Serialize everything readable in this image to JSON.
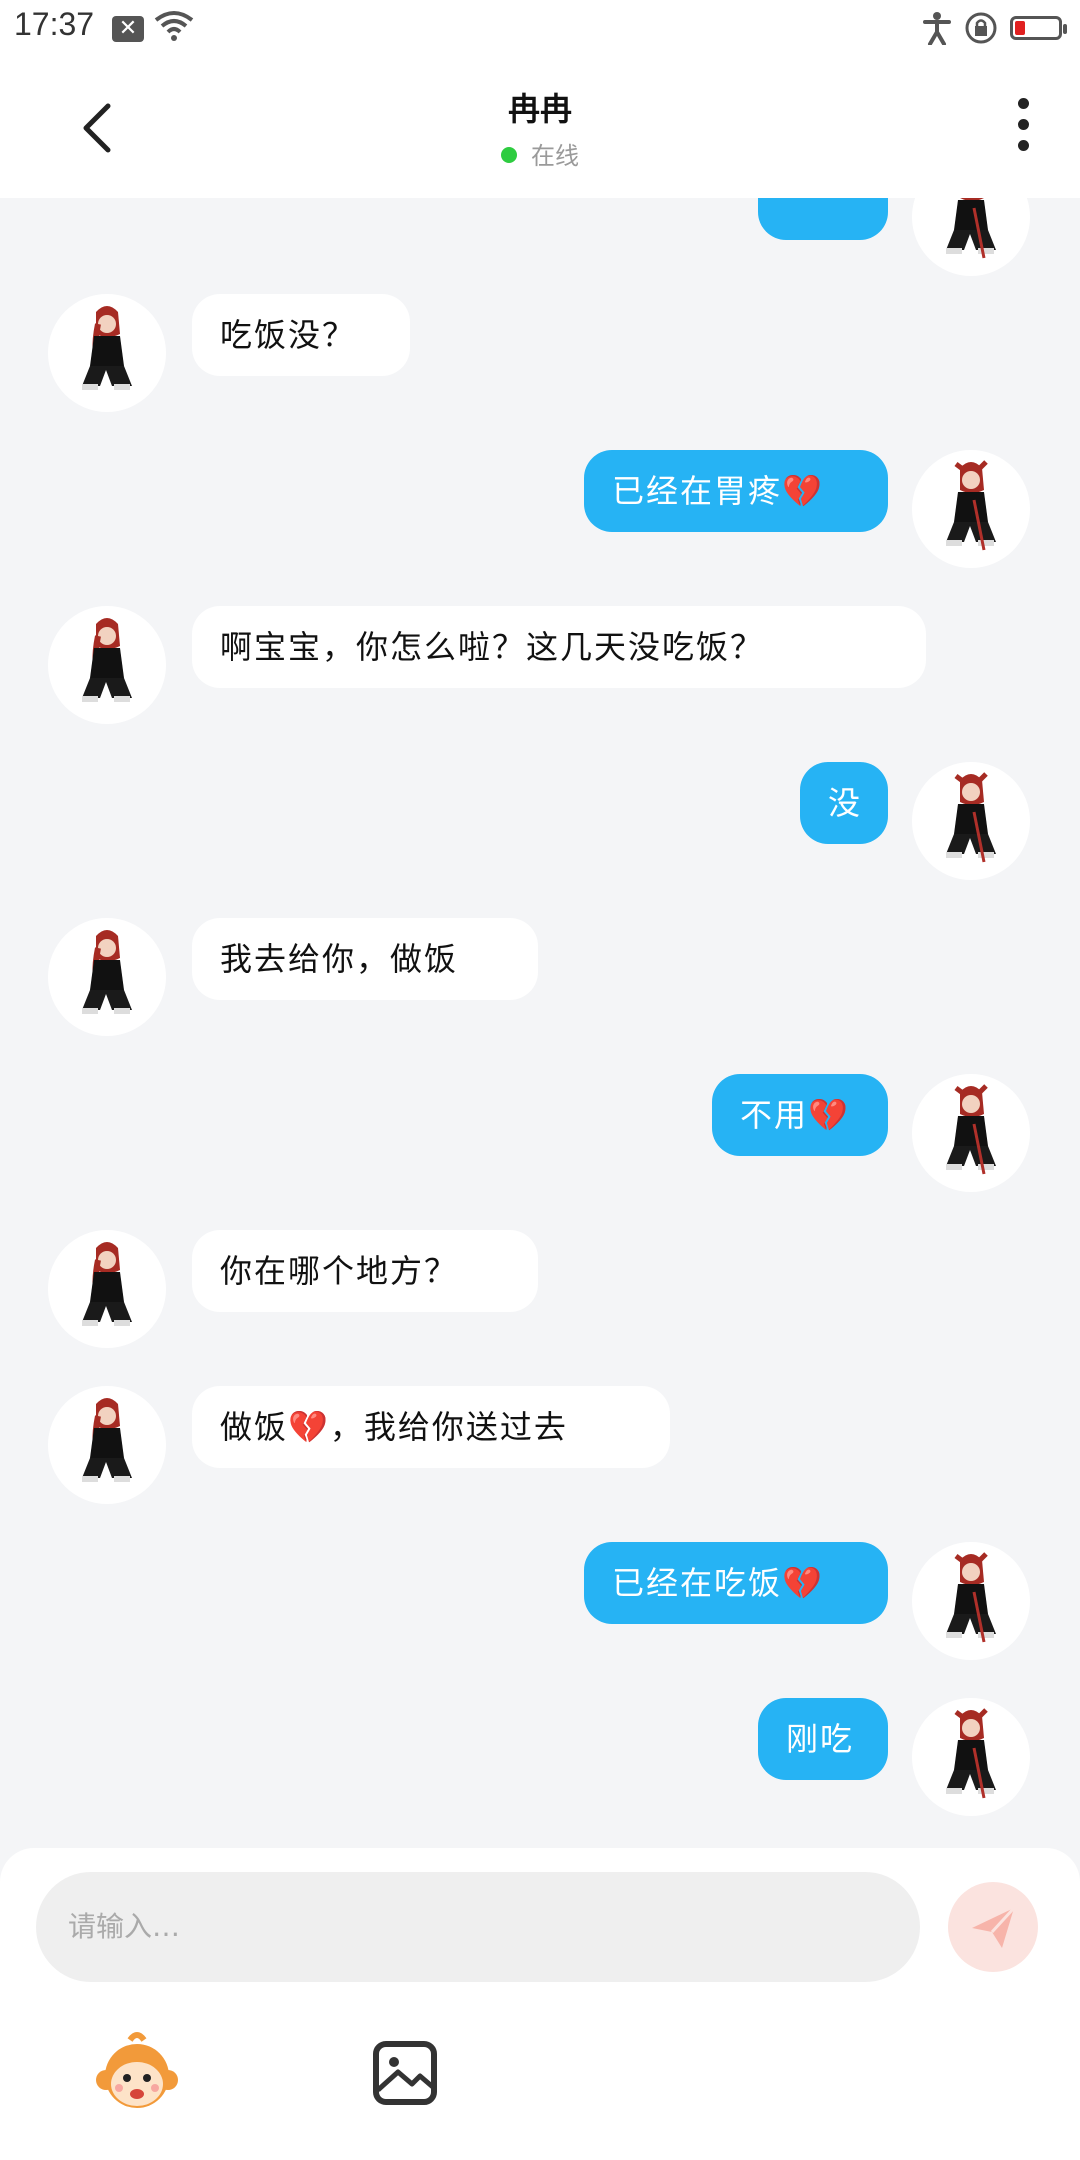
{
  "status_bar": {
    "time": "17:37"
  },
  "header": {
    "title": "冉冉",
    "status": "在线"
  },
  "messages": [
    {
      "side": "right",
      "text": ""
    },
    {
      "side": "left",
      "text": "吃饭没？"
    },
    {
      "side": "right",
      "text": "已经在胃疼💔"
    },
    {
      "side": "left",
      "text": "啊宝宝，你怎么啦？这几天没吃饭？"
    },
    {
      "side": "right",
      "text": "没"
    },
    {
      "side": "left",
      "text": "我去给你，做饭"
    },
    {
      "side": "right",
      "text": "不用💔"
    },
    {
      "side": "left",
      "text": "你在哪个地方？"
    },
    {
      "side": "left",
      "text": "做饭💔，我给你送过去"
    },
    {
      "side": "right",
      "text": "已经在吃饭💔"
    },
    {
      "side": "right",
      "text": "刚吃"
    }
  ],
  "composer": {
    "placeholder": "请输入…"
  },
  "colors": {
    "accent": "#26b3f4",
    "online": "#2ecc40",
    "send_disabled": "#fbe3df"
  }
}
